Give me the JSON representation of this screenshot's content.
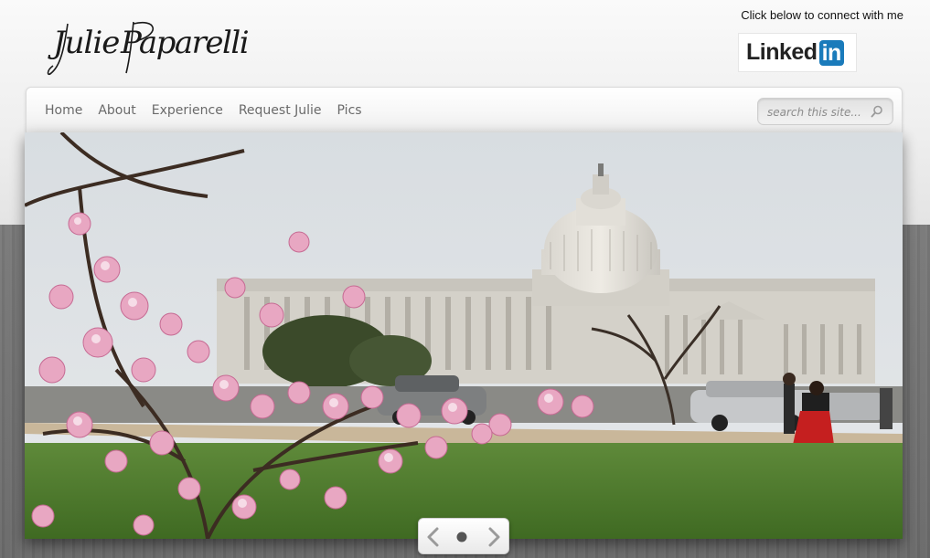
{
  "header": {
    "logo_text": "Julie Paparelli",
    "connect_text": "Click below to connect with me",
    "linkedin": {
      "word": "Linked",
      "badge": "in",
      "color": "#1a7bbb"
    }
  },
  "nav": {
    "items": [
      {
        "label": "Home"
      },
      {
        "label": "About"
      },
      {
        "label": "Experience"
      },
      {
        "label": "Request Julie"
      },
      {
        "label": "Pics"
      }
    ]
  },
  "search": {
    "placeholder": "search this site...",
    "value": ""
  },
  "slider": {
    "slide_count": 1,
    "current_slide": 1,
    "controls": {
      "prev_icon": "chevron-left-icon",
      "dot_icon": "slide-dot-icon",
      "next_icon": "chevron-right-icon"
    }
  },
  "colors": {
    "nav_text": "#6a6a6a",
    "page_dark": "#6e6e6e",
    "page_light": "#eeeeee"
  }
}
